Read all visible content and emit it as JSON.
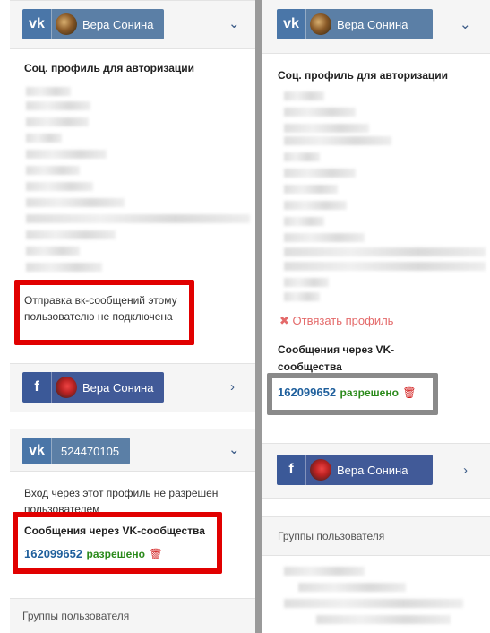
{
  "left": {
    "vk_panel": {
      "user_name": "Вера Сонина",
      "network_icon": "vk-icon"
    },
    "auth_title": "Соц. профиль для авторизации",
    "warning_text_line1": "Отправка вк-сообщений этому",
    "warning_text_line2": "пользователю не подключена",
    "fb_panel": {
      "user_name": "Вера Сонина",
      "network_icon": "facebook-icon"
    },
    "vk_id_panel": {
      "vk_id": "524470105"
    },
    "login_notice_line1": "Вход через этот профиль не разрешен",
    "login_notice_line2": "пользователем",
    "communities_title": "Сообщения через VK-сообщества",
    "community_id": "162099652",
    "community_status": "разрешено",
    "groups_label": "Группы пользователя"
  },
  "right": {
    "vk_panel": {
      "user_name": "Вера Сонина"
    },
    "auth_title": "Соц. профиль для авторизации",
    "unlink_label": "Отвязать профиль",
    "communities_title_line1": "Сообщения через VK-",
    "communities_title_line2": "сообщества",
    "community_id": "162099652",
    "community_status": "разрешено",
    "fb_panel": {
      "user_name": "Вера Сонина"
    },
    "groups_label": "Группы пользователя"
  },
  "colors": {
    "highlight_red": "#e10000",
    "highlight_gray": "#8a8a8a",
    "vk_blue": "#4a76a8",
    "fb_blue": "#3b5998",
    "allowed_green": "#2a8a1a"
  }
}
